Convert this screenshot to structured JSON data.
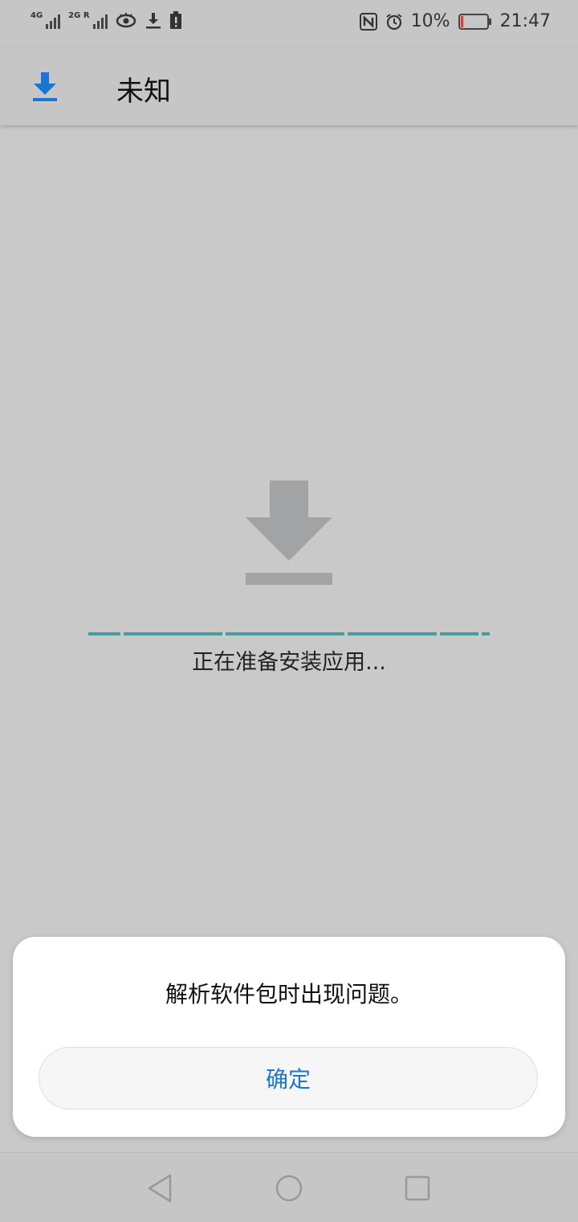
{
  "status_bar": {
    "signal1_label": "4G",
    "signal2_label": "2G R",
    "battery_percent": "10%",
    "battery_level": 0.1,
    "time": "21:47",
    "icons": [
      "signal-icon",
      "eye-icon",
      "download-icon",
      "battery-alert-icon",
      "nfc-icon",
      "alarm-icon",
      "battery-icon"
    ]
  },
  "app_bar": {
    "title": "未知",
    "icon": "download-icon",
    "accent": "#1976d2"
  },
  "main": {
    "icon": "download-large-icon",
    "status_text": "正在准备安装应用...",
    "progress_color": "#4a9a9e"
  },
  "dialog": {
    "message": "解析软件包时出现问题。",
    "ok_label": "确定"
  },
  "nav": {
    "icons": [
      "back-icon",
      "home-icon",
      "recents-icon"
    ]
  }
}
